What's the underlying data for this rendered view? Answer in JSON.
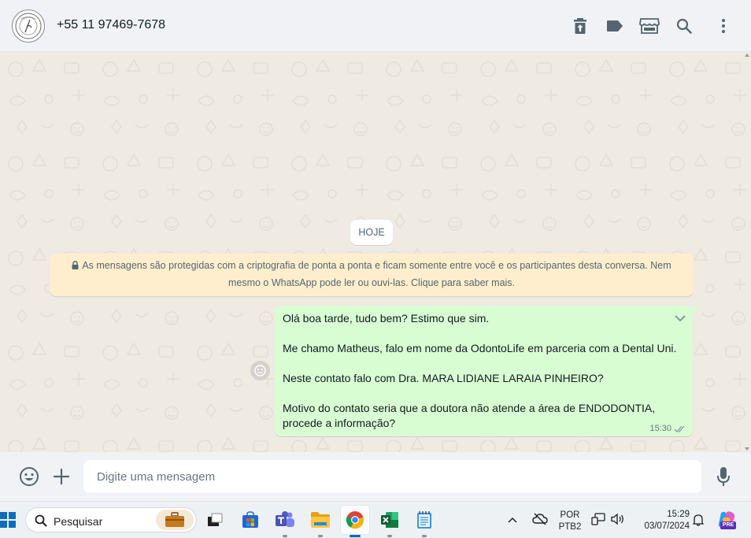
{
  "header": {
    "contact_name": "+55 11 97469-7678",
    "icons": [
      "trash-icon",
      "label-icon",
      "store-icon",
      "search-icon",
      "menu-icon"
    ]
  },
  "chat": {
    "date_label": "HOJE",
    "encryption_notice": "As mensagens são protegidas com a criptografia de ponta a ponta e ficam somente entre você e os participantes desta conversa. Nem mesmo o WhatsApp pode ler ou ouvi-las. Clique para saber mais.",
    "message": {
      "lines": [
        "Olá boa tarde, tudo bem? Estimo que sim.",
        "Me chamo Matheus, falo em nome da OdontoLife em parceria com a Dental Uni.",
        "Neste contato falo com Dra. MARA LIDIANE LARAIA PINHEIRO?",
        "Motivo do contato seria que a doutora não atende a área de ENDODONTIA, procede a informação?"
      ],
      "time": "15:30",
      "status": "read-double-check"
    }
  },
  "composer": {
    "placeholder": "Digite uma mensagem"
  },
  "taskbar": {
    "search_label": "Pesquisar",
    "apps": [
      "task-view",
      "microsoft-store",
      "teams",
      "file-explorer",
      "chrome",
      "excel",
      "notepad"
    ],
    "active_app": "chrome",
    "language_top": "POR",
    "language_bottom": "PTB2",
    "time": "15:29",
    "date": "03/07/2024",
    "copilot_badge": "PRE"
  },
  "colors": {
    "header_bg": "#f0f2f5",
    "chat_bg": "#efeae2",
    "outgoing_bubble": "#d9fdd3",
    "notice_bg": "#ffeecd",
    "read_tick": "#53bdeb",
    "icon_gray": "#54656f"
  }
}
